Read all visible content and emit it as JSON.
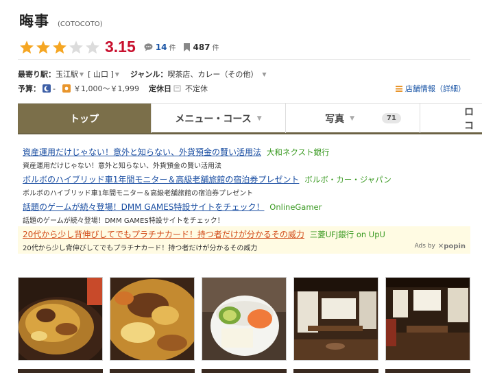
{
  "restaurant": {
    "name": "晦事",
    "reading": "(COTOCOTO)",
    "score": "3.15",
    "stars_filled": 3,
    "stars_total": 5,
    "reviews_count": "14",
    "reviews_unit": "件",
    "saves_count": "487",
    "saves_unit": "件"
  },
  "info": {
    "station_label": "最寄り駅：",
    "station_value": "玉江駅",
    "area_value": "[ 山口 ]",
    "genre_label": "ジャンル：",
    "genre_value": "喫茶店",
    "genre_sep": "、",
    "genre_value2": "カレー（その他）",
    "budget_label": "予算：",
    "budget_dinner": "-",
    "budget_lunch": "￥1,000～￥1,999",
    "holiday_label": "定休日",
    "holiday_value": "不定休",
    "detail_link": "店舗情報（詳細）"
  },
  "tabs": [
    {
      "label": "トップ"
    },
    {
      "label": "メニュー・コース"
    },
    {
      "label": "写真",
      "badge": "71"
    },
    {
      "label": "ロコ"
    }
  ],
  "ads": [
    {
      "title": "資産運用だけじゃない！意外と知らない、外貨預金の賢い活用法",
      "sponsor": "大和ネクスト銀行",
      "desc": "資産運用だけじゃない！意外と知らない、外貨預金の賢い活用法"
    },
    {
      "title": "ボルボのハイブリッド車1年間モニター＆高級老舗旅館の宿泊券プレゼント",
      "sponsor": "ボルボ・カー・ジャパン",
      "desc": "ボルボのハイブリッド車1年間モニター＆高級老舗旅館の宿泊券プレゼント"
    },
    {
      "title": "話題のゲームが続々登場！DMM GAMES特設サイトをチェック！",
      "sponsor": "OnlineGamer",
      "desc": "話題のゲームが続々登場！DMM GAMES特設サイトをチェック！"
    },
    {
      "title": "20代から少し背伸びしてでもプラチナカード！持つ者だけが分かるその威力",
      "sponsor": "三菱UFJ銀行 on UpU",
      "desc": "20代から少し背伸びしてでもプラチナカード！持つ者だけが分かるその威力"
    }
  ],
  "ads_by": "Ads by",
  "ads_brand": "popin",
  "colors": {
    "accent": "#7b6f4a",
    "score": "#c8102e",
    "link": "#1a4ea2",
    "sponsor": "#3a9a22",
    "star": "#f5a623"
  }
}
